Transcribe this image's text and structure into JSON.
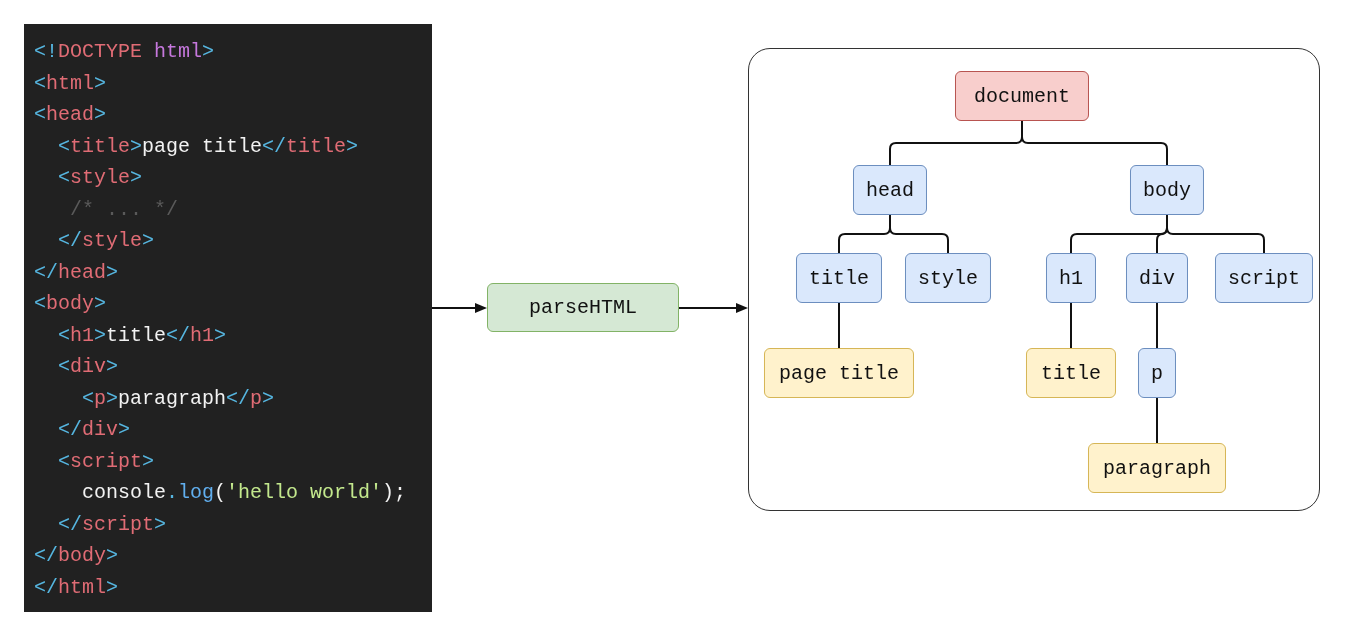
{
  "code": {
    "lines": [
      [
        {
          "kind": "punct",
          "text": "<!"
        },
        {
          "kind": "tag",
          "text": "DOCTYPE "
        },
        {
          "kind": "keyword",
          "text": "html"
        },
        {
          "kind": "punct",
          "text": ">"
        }
      ],
      [
        {
          "kind": "punct",
          "text": "<"
        },
        {
          "kind": "tag",
          "text": "html"
        },
        {
          "kind": "punct",
          "text": ">"
        }
      ],
      [
        {
          "kind": "punct",
          "text": "<"
        },
        {
          "kind": "tag",
          "text": "head"
        },
        {
          "kind": "punct",
          "text": ">"
        }
      ],
      [
        {
          "kind": "punct",
          "text": "  <"
        },
        {
          "kind": "tag",
          "text": "title"
        },
        {
          "kind": "punct",
          "text": ">"
        },
        {
          "kind": "text",
          "text": "page title"
        },
        {
          "kind": "punct",
          "text": "</"
        },
        {
          "kind": "tag",
          "text": "title"
        },
        {
          "kind": "punct",
          "text": ">"
        }
      ],
      [
        {
          "kind": "punct",
          "text": "  <"
        },
        {
          "kind": "tag",
          "text": "style"
        },
        {
          "kind": "punct",
          "text": ">"
        }
      ],
      [
        {
          "kind": "comment",
          "text": "   /* ... */"
        }
      ],
      [
        {
          "kind": "punct",
          "text": "  </"
        },
        {
          "kind": "tag",
          "text": "style"
        },
        {
          "kind": "punct",
          "text": ">"
        }
      ],
      [
        {
          "kind": "punct",
          "text": "</"
        },
        {
          "kind": "tag",
          "text": "head"
        },
        {
          "kind": "punct",
          "text": ">"
        }
      ],
      [
        {
          "kind": "punct",
          "text": "<"
        },
        {
          "kind": "tag",
          "text": "body"
        },
        {
          "kind": "punct",
          "text": ">"
        }
      ],
      [
        {
          "kind": "punct",
          "text": "  <"
        },
        {
          "kind": "tag",
          "text": "h1"
        },
        {
          "kind": "punct",
          "text": ">"
        },
        {
          "kind": "text",
          "text": "title"
        },
        {
          "kind": "punct",
          "text": "</"
        },
        {
          "kind": "tag",
          "text": "h1"
        },
        {
          "kind": "punct",
          "text": ">"
        }
      ],
      [
        {
          "kind": "punct",
          "text": "  <"
        },
        {
          "kind": "tag",
          "text": "div"
        },
        {
          "kind": "punct",
          "text": ">"
        }
      ],
      [
        {
          "kind": "punct",
          "text": "    <"
        },
        {
          "kind": "tag",
          "text": "p"
        },
        {
          "kind": "punct",
          "text": ">"
        },
        {
          "kind": "text",
          "text": "paragraph"
        },
        {
          "kind": "punct",
          "text": "</"
        },
        {
          "kind": "tag",
          "text": "p"
        },
        {
          "kind": "punct",
          "text": ">"
        }
      ],
      [
        {
          "kind": "punct",
          "text": "  </"
        },
        {
          "kind": "tag",
          "text": "div"
        },
        {
          "kind": "punct",
          "text": ">"
        }
      ],
      [
        {
          "kind": "punct",
          "text": "  <"
        },
        {
          "kind": "tag",
          "text": "script"
        },
        {
          "kind": "punct",
          "text": ">"
        }
      ],
      [
        {
          "kind": "text",
          "text": "    console"
        },
        {
          "kind": "punct",
          "text": "."
        },
        {
          "kind": "method",
          "text": "log"
        },
        {
          "kind": "text",
          "text": "("
        },
        {
          "kind": "string",
          "text": "'hello world'"
        },
        {
          "kind": "text",
          "text": ");"
        }
      ],
      [
        {
          "kind": "punct",
          "text": "  </"
        },
        {
          "kind": "tag",
          "text": "script"
        },
        {
          "kind": "punct",
          "text": ">"
        }
      ],
      [
        {
          "kind": "punct",
          "text": "</"
        },
        {
          "kind": "tag",
          "text": "body"
        },
        {
          "kind": "punct",
          "text": ">"
        }
      ],
      [
        {
          "kind": "punct",
          "text": "</"
        },
        {
          "kind": "tag",
          "text": "html"
        },
        {
          "kind": "punct",
          "text": ">"
        }
      ]
    ]
  },
  "parser": {
    "label": "parseHTML"
  },
  "tree": {
    "label": "document",
    "kind": "root",
    "children": [
      {
        "label": "head",
        "kind": "element",
        "children": [
          {
            "label": "title",
            "kind": "element",
            "children": [
              {
                "label": "page title",
                "kind": "text"
              }
            ]
          },
          {
            "label": "style",
            "kind": "element"
          }
        ]
      },
      {
        "label": "body",
        "kind": "element",
        "children": [
          {
            "label": "h1",
            "kind": "element",
            "children": [
              {
                "label": "title",
                "kind": "text"
              }
            ]
          },
          {
            "label": "div",
            "kind": "element",
            "children": [
              {
                "label": "p",
                "kind": "element",
                "children": [
                  {
                    "label": "paragraph",
                    "kind": "text"
                  }
                ]
              }
            ]
          },
          {
            "label": "script",
            "kind": "element"
          }
        ]
      }
    ]
  }
}
